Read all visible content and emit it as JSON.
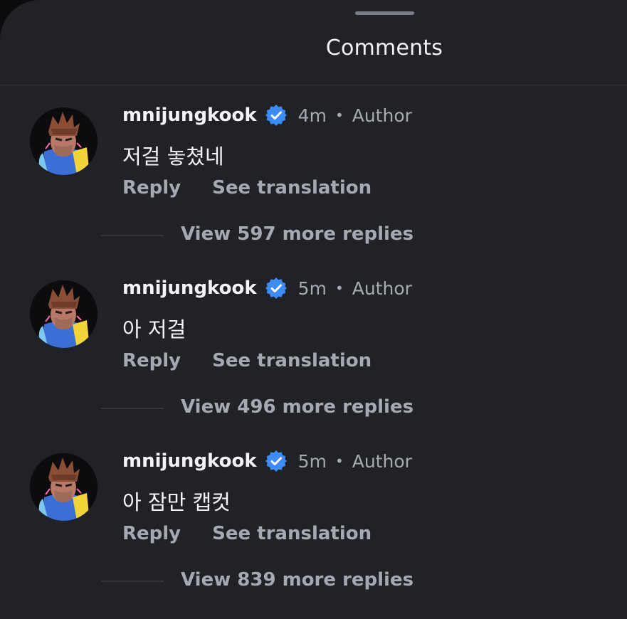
{
  "sheet": {
    "title": "Comments"
  },
  "comments": [
    {
      "username": "mnijungkook",
      "time": "4m",
      "separator": "•",
      "role": "Author",
      "text": "저걸 놓쳤네",
      "reply_label": "Reply",
      "translate_label": "See translation",
      "view_replies_label": "View 597 more replies"
    },
    {
      "username": "mnijungkook",
      "time": "5m",
      "separator": "•",
      "role": "Author",
      "text": "아 저걸",
      "reply_label": "Reply",
      "translate_label": "See translation",
      "view_replies_label": "View 496 more replies"
    },
    {
      "username": "mnijungkook",
      "time": "5m",
      "separator": "•",
      "role": "Author",
      "text": "아 잠만 캡컷",
      "reply_label": "Reply",
      "translate_label": "See translation",
      "view_replies_label": "View 839 more replies"
    }
  ],
  "icons": {
    "verified": "verified-badge-icon",
    "avatar": "avatar-image"
  },
  "colors": {
    "background": "#212227",
    "verified_badge": "#3d8bf5",
    "primary_text": "#f3f4f6",
    "secondary_text": "#a7a9b0"
  }
}
